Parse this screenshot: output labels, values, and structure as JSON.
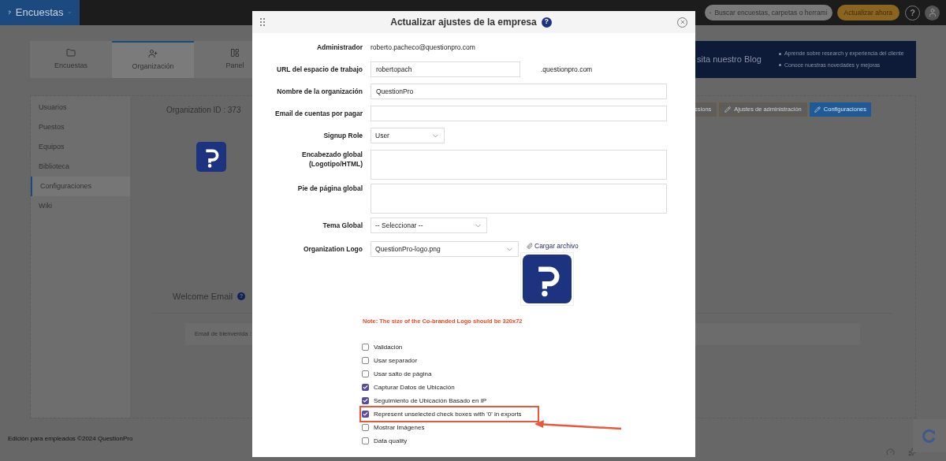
{
  "topbar": {
    "product": "Encuestas",
    "search": {
      "placeholder": "Buscar encuestas, carpetas o herrami"
    },
    "upgrade_button": "Actualizar ahora",
    "help": "?"
  },
  "nav_tabs": [
    {
      "label": "Encuestas",
      "selected": false
    },
    {
      "label": "Organización",
      "selected": true
    },
    {
      "label": "Panel",
      "selected": false
    }
  ],
  "banner": {
    "title": "sita nuestro Blog",
    "bullets": [
      "Aprende sobre research y experiencia del cliente",
      "Conoce nuestras novedades y mejoras"
    ]
  },
  "sidebar": {
    "items": [
      {
        "label": "Usuarios",
        "selected": false
      },
      {
        "label": "Puestos",
        "selected": false
      },
      {
        "label": "Equipos",
        "selected": false
      },
      {
        "label": "Biblioteca",
        "selected": false
      },
      {
        "label": "Configuraciones",
        "selected": true
      },
      {
        "label": "Wiki",
        "selected": false
      }
    ]
  },
  "organization_id": "Organization ID : 373",
  "action_buttons": [
    {
      "label": "ssions",
      "kind": "gray"
    },
    {
      "label": "Ajustes de administración",
      "kind": "gray"
    },
    {
      "label": "Configuraciones",
      "kind": "blue"
    }
  ],
  "welcome_email": {
    "title": "Welcome Email",
    "help": "?",
    "field_label": "Email de bienvenida :"
  },
  "footer": "Edición para empleados ©2024 QuestionPro",
  "dialog": {
    "title": "Actualizar ajustes de la empresa",
    "help": "?",
    "fields": [
      {
        "kind": "text",
        "label": "Administrador",
        "value": "roberto.pacheco@questionpro.com"
      },
      {
        "kind": "short_input",
        "label": "URL del espacio de trabajo",
        "value": "robertopach",
        "suffix": ".questionpro.com"
      },
      {
        "kind": "input",
        "label": "Nombre de la organización",
        "value": "QuestionPro"
      },
      {
        "kind": "input",
        "label": "Email de cuentas por pagar"
      },
      {
        "kind": "select",
        "label": "Signup Role",
        "value": "User"
      },
      {
        "kind": "textarea",
        "label": "Encabezado global (Logotipo/HTML)"
      },
      {
        "kind": "textarea",
        "label": "Pie de página global"
      },
      {
        "kind": "select",
        "label": "Tema Global",
        "value": "-- Seleccionar --"
      }
    ],
    "logo": {
      "label": "Organization Logo",
      "value": "QuestionPro-logo.png",
      "upload_link": "Cargar archivo",
      "note": "Note: The size of the Co-branded Logo should be 320x72"
    },
    "checkboxes": [
      {
        "label": "Validación",
        "checked": false,
        "highlighted": false
      },
      {
        "label": "Usar separador",
        "checked": false,
        "highlighted": false
      },
      {
        "label": "Usar salto de página",
        "checked": false,
        "highlighted": false
      },
      {
        "label": "Capturar Datos de Ubicación",
        "checked": true,
        "highlighted": false
      },
      {
        "label": "Seguimiento de Ubicación Basado en IP",
        "checked": true,
        "highlighted": false
      },
      {
        "label": "Represent unselected check boxes with '0' in exports",
        "checked": true,
        "highlighted": true
      },
      {
        "label": "Mostrar Imágenes",
        "checked": false,
        "highlighted": false
      },
      {
        "label": "Data quality",
        "checked": false,
        "highlighted": false
      }
    ]
  }
}
